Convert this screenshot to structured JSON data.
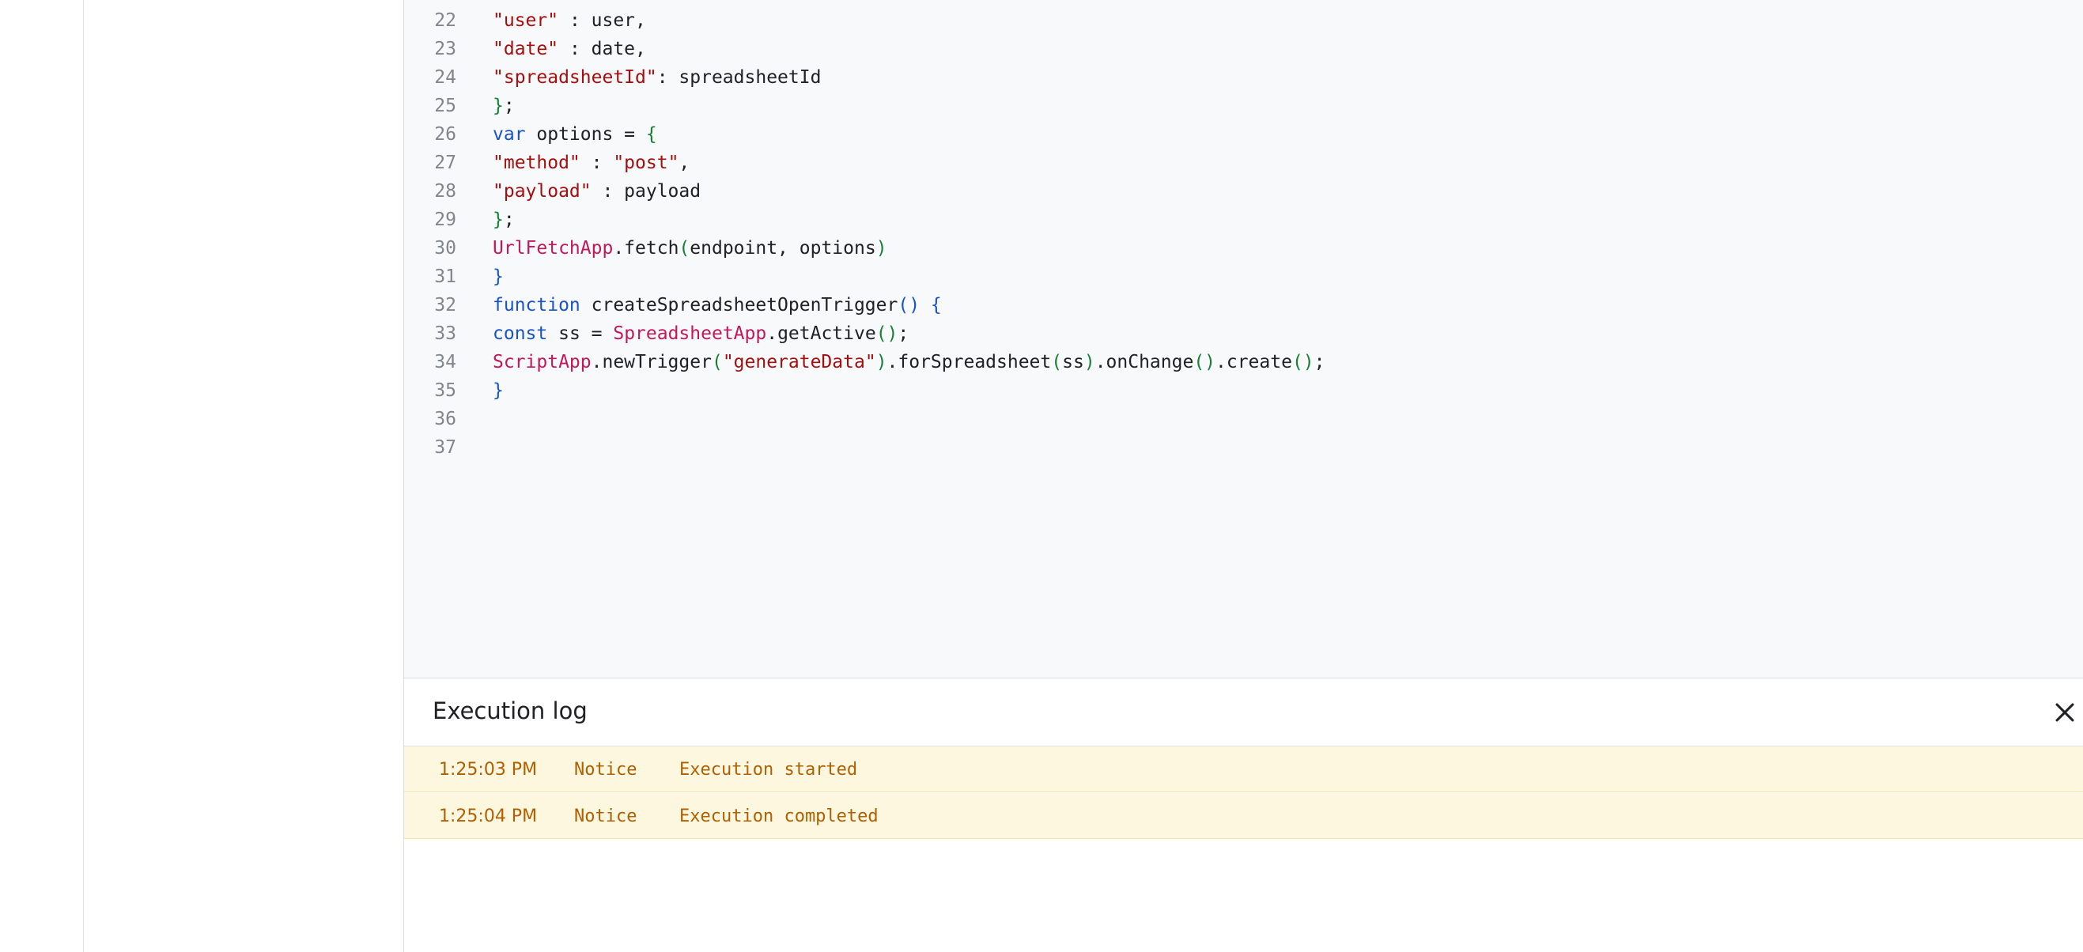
{
  "editor": {
    "lines": [
      {
        "n": "22",
        "tokens": [
          {
            "t": "\"user\"",
            "c": "str"
          },
          {
            "t": " : user,",
            "c": "txt"
          }
        ]
      },
      {
        "n": "23",
        "tokens": [
          {
            "t": "\"date\"",
            "c": "str"
          },
          {
            "t": " : date,",
            "c": "txt"
          }
        ]
      },
      {
        "n": "24",
        "tokens": [
          {
            "t": "\"spreadsheetId\"",
            "c": "str"
          },
          {
            "t": ": spreadsheetId",
            "c": "txt"
          }
        ]
      },
      {
        "n": "25",
        "tokens": [
          {
            "t": "}",
            "c": "br"
          },
          {
            "t": ";",
            "c": "txt"
          }
        ]
      },
      {
        "n": "26",
        "tokens": [
          {
            "t": "var",
            "c": "kw"
          },
          {
            "t": " options = ",
            "c": "txt"
          },
          {
            "t": "{",
            "c": "br"
          }
        ]
      },
      {
        "n": "27",
        "tokens": [
          {
            "t": "\"method\"",
            "c": "str"
          },
          {
            "t": " : ",
            "c": "txt"
          },
          {
            "t": "\"post\"",
            "c": "str"
          },
          {
            "t": ",",
            "c": "txt"
          }
        ]
      },
      {
        "n": "28",
        "tokens": [
          {
            "t": "\"payload\"",
            "c": "str"
          },
          {
            "t": " : payload",
            "c": "txt"
          }
        ]
      },
      {
        "n": "29",
        "tokens": [
          {
            "t": "}",
            "c": "br"
          },
          {
            "t": ";",
            "c": "txt"
          }
        ]
      },
      {
        "n": "30",
        "tokens": [
          {
            "t": "UrlFetchApp",
            "c": "cls"
          },
          {
            "t": ".fetch",
            "c": "txt"
          },
          {
            "t": "(",
            "c": "par"
          },
          {
            "t": "endpoint, options",
            "c": "txt"
          },
          {
            "t": ")",
            "c": "par"
          }
        ]
      },
      {
        "n": "31",
        "tokens": [
          {
            "t": "}",
            "c": "br2"
          }
        ]
      },
      {
        "n": "32",
        "tokens": [
          {
            "t": "function",
            "c": "kw"
          },
          {
            "t": " createSpreadsheetOpenTrigger",
            "c": "txt"
          },
          {
            "t": "()",
            "c": "br2"
          },
          {
            "t": " ",
            "c": "txt"
          },
          {
            "t": "{",
            "c": "br2"
          }
        ]
      },
      {
        "n": "33",
        "tokens": [
          {
            "t": "const",
            "c": "kw"
          },
          {
            "t": " ss = ",
            "c": "txt"
          },
          {
            "t": "SpreadsheetApp",
            "c": "cls"
          },
          {
            "t": ".getActive",
            "c": "txt"
          },
          {
            "t": "()",
            "c": "par"
          },
          {
            "t": ";",
            "c": "txt"
          }
        ]
      },
      {
        "n": "34",
        "tokens": [
          {
            "t": "ScriptApp",
            "c": "cls"
          },
          {
            "t": ".newTrigger",
            "c": "txt"
          },
          {
            "t": "(",
            "c": "par"
          },
          {
            "t": "\"generateData\"",
            "c": "str"
          },
          {
            "t": ")",
            "c": "par"
          },
          {
            "t": ".forSpreadsheet",
            "c": "txt"
          },
          {
            "t": "(",
            "c": "par"
          },
          {
            "t": "ss",
            "c": "txt"
          },
          {
            "t": ")",
            "c": "par"
          },
          {
            "t": ".onChange",
            "c": "txt"
          },
          {
            "t": "()",
            "c": "par"
          },
          {
            "t": ".create",
            "c": "txt"
          },
          {
            "t": "()",
            "c": "par"
          },
          {
            "t": ";",
            "c": "txt"
          }
        ]
      },
      {
        "n": "35",
        "tokens": [
          {
            "t": "}",
            "c": "br2"
          }
        ]
      },
      {
        "n": "36",
        "tokens": []
      },
      {
        "n": "37",
        "tokens": []
      }
    ]
  },
  "execution_log": {
    "title": "Execution log",
    "close_icon": "close-icon",
    "entries": [
      {
        "time": "1:25:03 PM",
        "level": "Notice",
        "message": "Execution started"
      },
      {
        "time": "1:25:04 PM",
        "level": "Notice",
        "message": "Execution completed"
      }
    ]
  },
  "colors": {
    "string": "#a50e0e",
    "keyword": "#1a53c7",
    "class": "#c2185b",
    "paren": "#188038",
    "log_row_bg": "#fef7e0",
    "log_text": "#b06000"
  }
}
